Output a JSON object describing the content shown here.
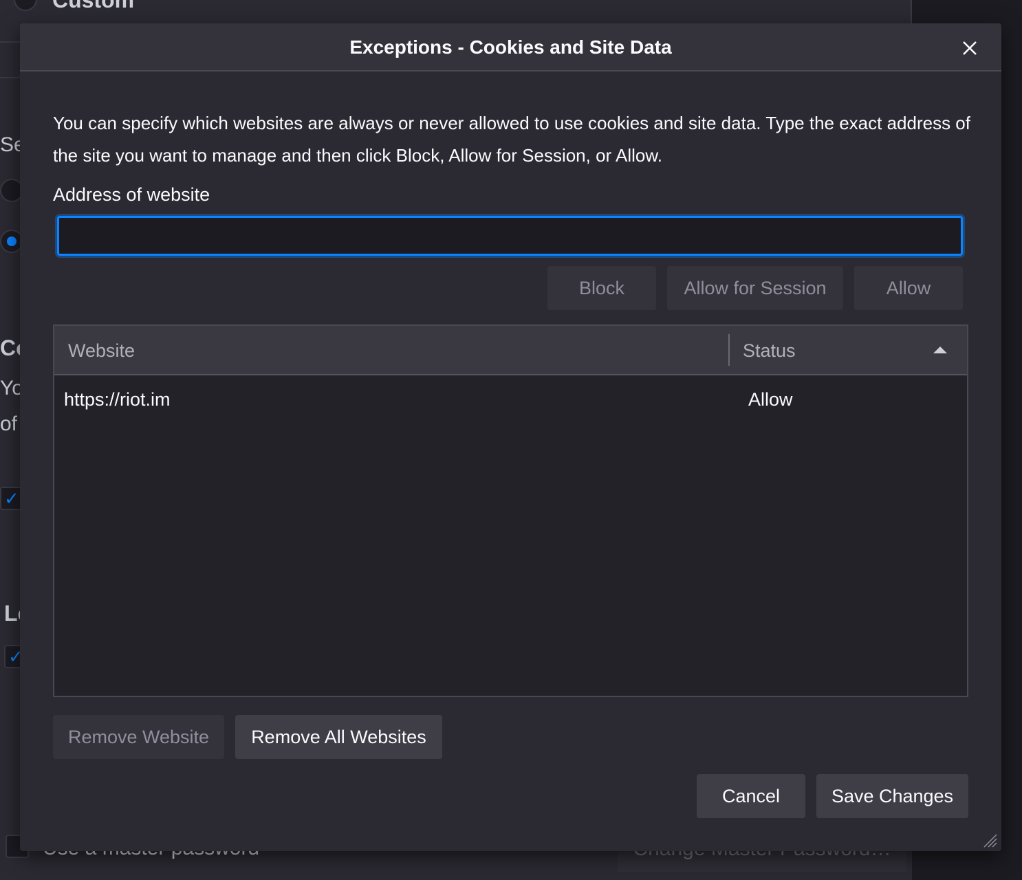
{
  "background": {
    "custom_label": "Custom",
    "section_fragment": "Se",
    "cookies_fragment": "Co",
    "you_fragment": "Yo",
    "of_fragment": "of",
    "logins_fragment": "Lo",
    "master_password_label": "Use a master password",
    "change_master_password": "Change Master Password…"
  },
  "dialog": {
    "title": "Exceptions - Cookies and Site Data",
    "description": "You can specify which websites are always or never allowed to use cookies and site data. Type the exact address of the site you want to manage and then click Block, Allow for Session, or Allow.",
    "address_label": "Address of website",
    "address_value": "",
    "buttons": {
      "block": "Block",
      "allow_session": "Allow for Session",
      "allow": "Allow",
      "remove_website": "Remove Website",
      "remove_all": "Remove All Websites",
      "cancel": "Cancel",
      "save": "Save Changes"
    },
    "table": {
      "columns": [
        "Website",
        "Status"
      ],
      "rows": [
        {
          "website": "https://riot.im",
          "status": "Allow"
        }
      ]
    }
  },
  "colors": {
    "accent": "#0a84ff",
    "dialog_bg": "#2b2a33",
    "text": "#fbfbfe"
  }
}
